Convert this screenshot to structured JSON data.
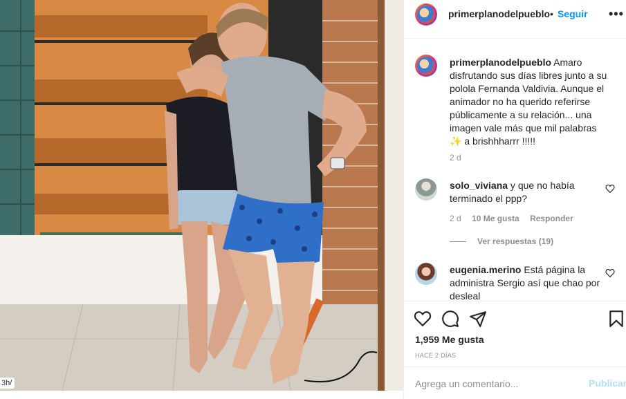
{
  "photo": {
    "corner_tag": "3h/",
    "alt": ""
  },
  "header": {
    "username": "primerplanodelpueblo",
    "separator": "•",
    "follow_label": "Seguir",
    "more_icon": "more-horizontal-icon"
  },
  "caption": {
    "username": "primerplanodelpueblo",
    "text": " Amaro disfrutando sus días libres junto a su polola Fernanda Valdivia. Aunque el animador no ha querido referirse públicamente a su relación... una imagen vale más que mil palabras ✨ a brishhharrr !!!!!",
    "time": "2 d"
  },
  "comments": [
    {
      "username": "solo_viviana",
      "text": " y que no había terminado el ppp?",
      "time": "2 d",
      "likes": "10 Me gusta",
      "reply_label": "Responder",
      "view_replies": "Ver respuestas (19)"
    },
    {
      "username": "eugenia.merino",
      "text": " Está página la administra Sergio así que chao por desleal"
    }
  ],
  "actions": {
    "like_icon": "heart-icon",
    "comment_icon": "comment-icon",
    "share_icon": "send-icon",
    "save_icon": "bookmark-icon",
    "likes_count": "1,959 Me gusta",
    "date": "HACE 2 DÍAS"
  },
  "add_comment": {
    "placeholder": "Agrega un comentario...",
    "publish_label": "Publicar"
  },
  "colors": {
    "accent": "#0095f6",
    "publish_disabled": "#b2dffc",
    "muted": "#8e8e8e",
    "text": "#262626"
  }
}
